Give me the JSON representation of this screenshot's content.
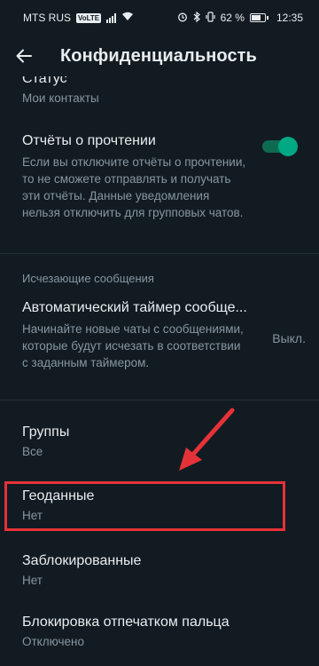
{
  "statusbar": {
    "carrier": "MTS RUS",
    "volte": "VoLTE",
    "battery": "62 %",
    "time": "12:35"
  },
  "appbar": {
    "title": "Конфиденциальность",
    "back_icon": "arrow-left-icon"
  },
  "items": {
    "status": {
      "label": "Статус",
      "value": "Мои контакты"
    },
    "read_receipts": {
      "label": "Отчёты о прочтении",
      "description": "Если вы отключите отчёты о прочтении, то не сможете отправлять и получать эти отчёты. Данные уведомления нельзя отключить для групповых чатов.",
      "enabled": true
    },
    "disappearing_header": "Исчезающие сообщения",
    "auto_timer": {
      "label": "Автоматический таймер сообще...",
      "description": "Начинайте новые чаты с сообщениями, которые будут исчезать в соответствии с заданным таймером.",
      "value": "Выкл."
    },
    "groups": {
      "label": "Группы",
      "value": "Все"
    },
    "location": {
      "label": "Геоданные",
      "value": "Нет"
    },
    "blocked": {
      "label": "Заблокированные",
      "value": "Нет"
    },
    "fingerprint": {
      "label": "Блокировка отпечатком пальца",
      "value": "Отключено"
    }
  },
  "colors": {
    "background": "#121b22",
    "accent": "#00a884",
    "annotation": "#e53238"
  }
}
